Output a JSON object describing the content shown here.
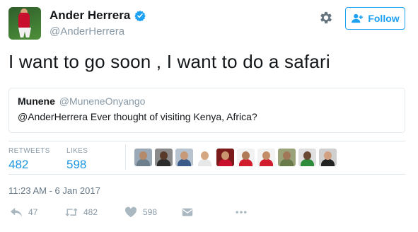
{
  "header": {
    "display_name": "Ander Herrera",
    "handle": "@AnderHerrera",
    "follow_label": "Follow"
  },
  "tweet": {
    "text": "I want to go soon , I want to do a safari"
  },
  "quoted_tweet": {
    "name": "Munene",
    "handle": "@MuneneOnyango",
    "text": "@AnderHerrera Ever thought of visiting Kenya, Africa?"
  },
  "stats": {
    "retweets_label": "RETWEETS",
    "retweets_value": "482",
    "likes_label": "LIKES",
    "likes_value": "598"
  },
  "likers": [
    {
      "face": "#b58a6a",
      "body": "#6d7f8c",
      "bg": "#9aa9b5"
    },
    {
      "face": "#5a3a28",
      "body": "#2b2b2b",
      "bg": "#8a8a8a"
    },
    {
      "face": "#c89a78",
      "body": "#3c5a8a",
      "bg": "#b7c3cf"
    },
    {
      "face": "#d6a882",
      "body": "#e8e8e8",
      "bg": "#ffffff"
    },
    {
      "face": "#c9966f",
      "body": "#c8102e",
      "bg": "#7a1a1a"
    },
    {
      "face": "#b07a58",
      "body": "#d01c2c",
      "bg": "#f2f2f2"
    },
    {
      "face": "#c48d6a",
      "body": "#d01c2c",
      "bg": "#f2f2f2"
    },
    {
      "face": "#a07858",
      "body": "#6b7a4a",
      "bg": "#9aa27a"
    },
    {
      "face": "#6b4a34",
      "body": "#2e8b3a",
      "bg": "#e0e0e0"
    },
    {
      "face": "#d0a080",
      "body": "#222222",
      "bg": "#cfcfcf"
    }
  ],
  "timestamp": "11:23 AM - 6 Jan 2017",
  "actions": {
    "reply_count": "47",
    "retweet_count": "482",
    "like_count": "598"
  },
  "colors": {
    "accent": "#1da1f2",
    "muted": "#8899a6",
    "link_number": "#1b95e0",
    "border": "#e1e8ed"
  },
  "icons": {
    "verified": "verified-badge-icon",
    "settings": "gear-icon",
    "follow": "add-user-icon",
    "reply": "reply-icon",
    "retweet": "retweet-icon",
    "like": "heart-icon",
    "direct_message": "envelope-icon",
    "more": "more-dots-icon"
  }
}
